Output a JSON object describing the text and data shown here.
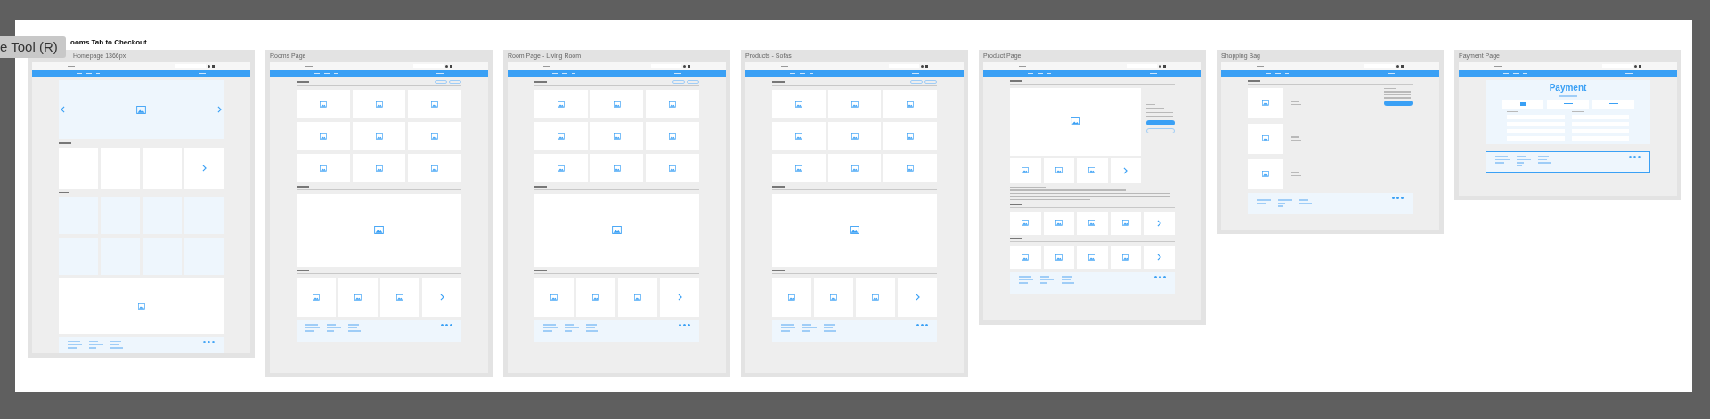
{
  "tooltip": {
    "label": "e Tool (R)"
  },
  "flow": {
    "title": "ooms Tab to Checkout"
  },
  "frames": [
    {
      "title": "Homepage 1366px",
      "kind": "home"
    },
    {
      "title": "Rooms Page",
      "kind": "grid"
    },
    {
      "title": "Room Page - Living Room",
      "kind": "room"
    },
    {
      "title": "Products - Sofas",
      "kind": "room"
    },
    {
      "title": "Product Page",
      "kind": "product"
    },
    {
      "title": "Shopping Bag",
      "kind": "bag"
    },
    {
      "title": "Payment Page",
      "kind": "payment",
      "heading": "Payment"
    }
  ]
}
